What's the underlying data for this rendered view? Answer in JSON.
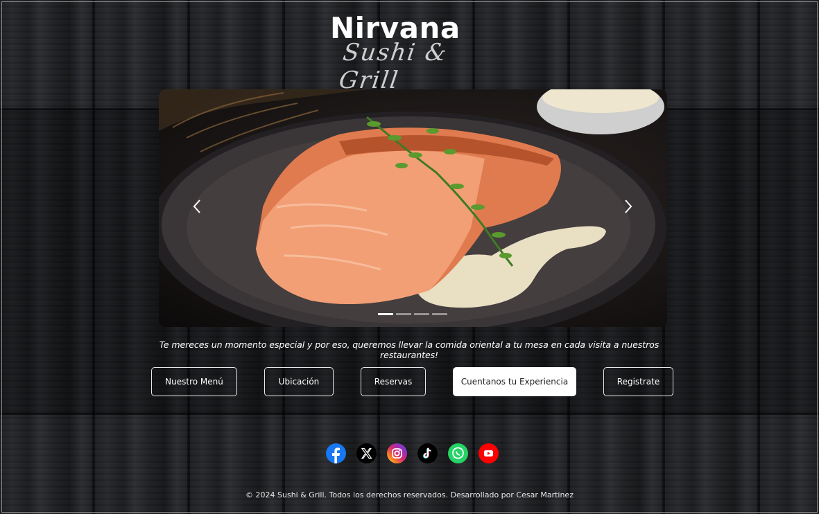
{
  "brand": {
    "name": "Nirvana",
    "subtitle": "Sushi & Grill"
  },
  "carousel": {
    "slide_count": 4,
    "active_index": 0,
    "slide_description_icon": "grilled-salmon-photo"
  },
  "tagline": "Te mereces un momento especial y por eso, queremos llevar la comida oriental a tu mesa en cada visita a nuestros restaurantes!",
  "nav": {
    "menu": "Nuestro Menú",
    "location": "Ubicación",
    "reservations": "Reservas",
    "experience": "Cuentanos tu Experiencia",
    "register": "Registrate"
  },
  "socials": [
    {
      "name": "facebook-icon",
      "color": "#1877f2"
    },
    {
      "name": "x-icon",
      "color": "#000000"
    },
    {
      "name": "instagram-icon",
      "color": "#d62976"
    },
    {
      "name": "tiktok-icon",
      "color": "#000000"
    },
    {
      "name": "whatsapp-icon",
      "color": "#25d366"
    },
    {
      "name": "youtube-icon",
      "color": "#ff0000"
    }
  ],
  "footer": "© 2024 Sushi & Grill. Todos los derechos reservados. Desarrollado por Cesar Martinez"
}
